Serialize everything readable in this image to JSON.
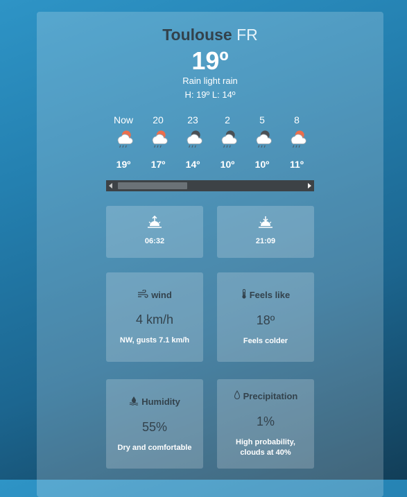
{
  "location": {
    "city": "Toulouse",
    "country": "FR"
  },
  "current": {
    "temperature": "19º",
    "description": "Rain light rain",
    "high_low": "H: 19º L: 14º"
  },
  "hourly": [
    {
      "time": "Now",
      "temp": "19º",
      "icon": "rain-sun-icon"
    },
    {
      "time": "20",
      "temp": "17º",
      "icon": "rain-sun-icon"
    },
    {
      "time": "23",
      "temp": "14º",
      "icon": "rain-moon-icon"
    },
    {
      "time": "2",
      "temp": "10º",
      "icon": "rain-moon-icon"
    },
    {
      "time": "5",
      "temp": "10º",
      "icon": "rain-moon-icon"
    },
    {
      "time": "8",
      "temp": "11º",
      "icon": "rain-sun-icon"
    }
  ],
  "sun": {
    "sunrise": "06:32",
    "sunset": "21:09"
  },
  "wind": {
    "title": "wind",
    "value": "4 km/h",
    "note": "NW, gusts 7.1 km/h"
  },
  "feels_like": {
    "title": "Feels like",
    "value": "18º",
    "note": "Feels colder"
  },
  "humidity": {
    "title": "Humidity",
    "value": "55%",
    "note": "Dry and comfortable"
  },
  "precipitation": {
    "title": "Precipitation",
    "value": "1%",
    "note": "High probability, clouds at 40%"
  },
  "colors": {
    "sun": "#ec6e4c",
    "moon": "#4a4f54",
    "cloud": "#ffffff",
    "dark_text": "#33424c"
  }
}
